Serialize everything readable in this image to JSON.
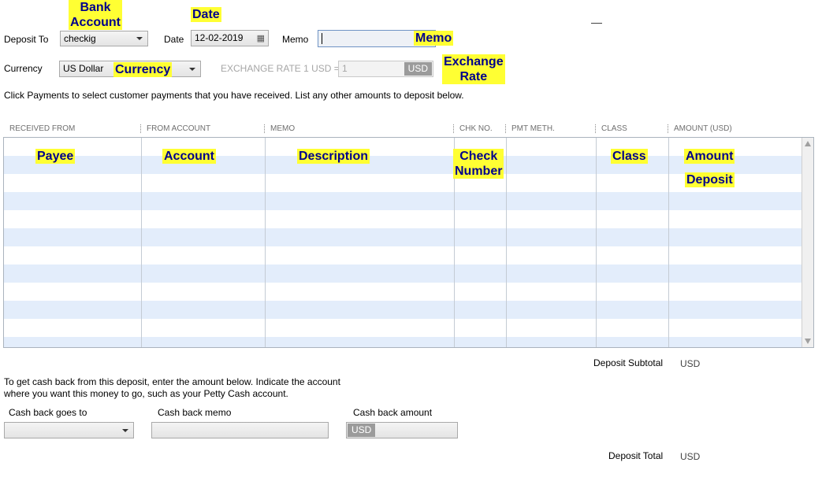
{
  "header": {
    "deposit_to_label": "Deposit To",
    "deposit_to_value": "checkig",
    "date_label": "Date",
    "date_value": "12-02-2019",
    "memo_label": "Memo",
    "memo_value": "",
    "currency_label": "Currency",
    "currency_value": "US Dollar",
    "exchange_rate_label": "EXCHANGE RATE 1 USD =",
    "exchange_rate_value": "1",
    "exchange_rate_unit": "USD",
    "minimize_glyph": "—"
  },
  "instructions": "Click Payments to select customer payments that you have received. List any other amounts to deposit below.",
  "table": {
    "columns": [
      "RECEIVED FROM",
      "FROM ACCOUNT",
      "MEMO",
      "CHK NO.",
      "PMT METH.",
      "CLASS",
      "AMOUNT (USD)"
    ],
    "row_count": 12
  },
  "annotations": {
    "bank_account": "Bank\nAccount",
    "date": "Date",
    "memo": "Memo",
    "currency": "Currency",
    "exchange_rate": "Exchange\nRate",
    "payee": "Payee",
    "account": "Account",
    "description": "Description",
    "check_number": "Check\nNumber",
    "class": "Class",
    "amount": "Amount",
    "deposit": "Deposit"
  },
  "footer": {
    "subtotal_label": "Deposit Subtotal",
    "subtotal_unit": "USD",
    "cashback_note_line1": "To get cash back from this deposit, enter the amount below.  Indicate the account",
    "cashback_note_line2": "where you want this money to go, such as your Petty Cash account.",
    "cashback_goes_to_label": "Cash back goes to",
    "cashback_goes_to_value": "",
    "cashback_memo_label": "Cash back memo",
    "cashback_memo_value": "",
    "cashback_amount_label": "Cash back amount",
    "cashback_amount_unit": "USD",
    "cashback_amount_value": "",
    "total_label": "Deposit Total",
    "total_unit": "USD"
  }
}
